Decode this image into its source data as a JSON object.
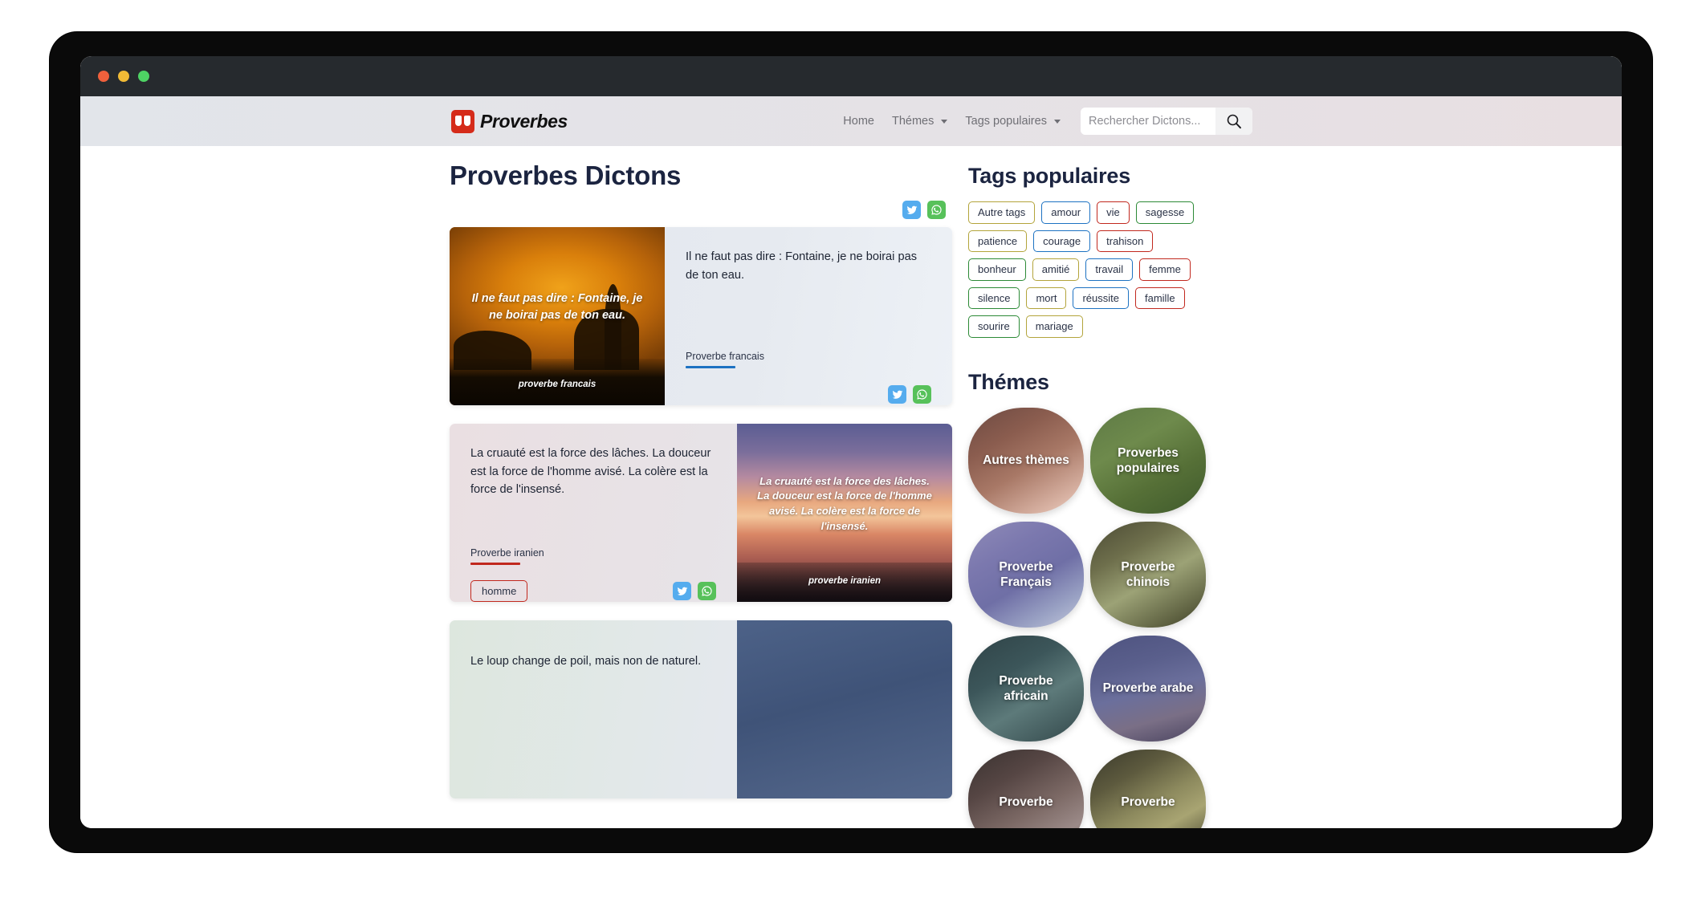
{
  "browser": {
    "traffic_lights": [
      "red",
      "yellow",
      "green"
    ]
  },
  "navbar": {
    "brand": "Proverbes",
    "links": [
      {
        "label": "Home",
        "caret": false
      },
      {
        "label": "Thémes",
        "caret": true
      },
      {
        "label": "Tags populaires",
        "caret": true
      }
    ],
    "search_placeholder": "Rechercher Dictons...",
    "search_value": "",
    "search_icon": "search-icon"
  },
  "main": {
    "page_title": "Proverbes Dictons",
    "top_share": [
      {
        "name": "twitter",
        "color": "#55acee"
      },
      {
        "name": "whatsapp",
        "color": "#57c15a"
      }
    ],
    "cards": [
      {
        "quote": "Il ne faut pas dire : Fontaine, je ne boirai pas de ton eau.",
        "source": "Proverbe francais",
        "source_color": "#1d72c2",
        "image_quote": "Il ne faut pas dire : Fontaine, je ne boirai pas de ton eau.",
        "image_credit": "proverbe francais",
        "image_side": "left",
        "tags": [],
        "share": [
          "twitter",
          "whatsapp"
        ]
      },
      {
        "quote": "La cruauté est la force des lâches. La douceur est la force de l'homme avisé. La colère est la force de l'insensé.",
        "source": "Proverbe iranien",
        "source_color": "#c1281e",
        "image_quote": "La cruauté est la force des lâches. La douceur est la force de l'homme avisé. La colère est la force de l'insensé.",
        "image_credit": "proverbe iranien",
        "image_side": "right",
        "tags": [
          "homme"
        ],
        "share": [
          "twitter",
          "whatsapp"
        ]
      },
      {
        "quote": "Le loup change de poil, mais non de naturel.",
        "source": "",
        "source_color": "#2c8a36",
        "image_quote": "",
        "image_credit": "",
        "image_side": "right",
        "tags": [],
        "share": []
      }
    ]
  },
  "sidebar": {
    "tags_heading": "Tags populaires",
    "tags": [
      {
        "label": "Autre tags",
        "color": "olive"
      },
      {
        "label": "amour",
        "color": "blue"
      },
      {
        "label": "vie",
        "color": "red"
      },
      {
        "label": "sagesse",
        "color": "green"
      },
      {
        "label": "patience",
        "color": "olive"
      },
      {
        "label": "courage",
        "color": "blue"
      },
      {
        "label": "trahison",
        "color": "red"
      },
      {
        "label": "bonheur",
        "color": "green"
      },
      {
        "label": "amitié",
        "color": "olive"
      },
      {
        "label": "travail",
        "color": "blue"
      },
      {
        "label": "femme",
        "color": "red"
      },
      {
        "label": "silence",
        "color": "green"
      },
      {
        "label": "mort",
        "color": "olive"
      },
      {
        "label": "réussite",
        "color": "blue"
      },
      {
        "label": "famille",
        "color": "red"
      },
      {
        "label": "sourire",
        "color": "green"
      },
      {
        "label": "mariage",
        "color": "olive"
      }
    ],
    "themes_heading": "Thémes",
    "themes": [
      {
        "label": "Autres thèmes"
      },
      {
        "label": "Proverbes populaires"
      },
      {
        "label": "Proverbe Français"
      },
      {
        "label": "Proverbe chinois"
      },
      {
        "label": "Proverbe africain"
      },
      {
        "label": "Proverbe arabe"
      },
      {
        "label": "Proverbe"
      },
      {
        "label": "Proverbe"
      }
    ]
  },
  "colors": {
    "brand_red": "#d52b1a",
    "title_navy": "#1b2440",
    "twitter_blue": "#55acee",
    "whatsapp_green": "#57c15a",
    "tag_olive": "#b3a43b",
    "tag_blue": "#1d72c2",
    "tag_red": "#c1281e",
    "tag_green": "#2c8a36"
  }
}
